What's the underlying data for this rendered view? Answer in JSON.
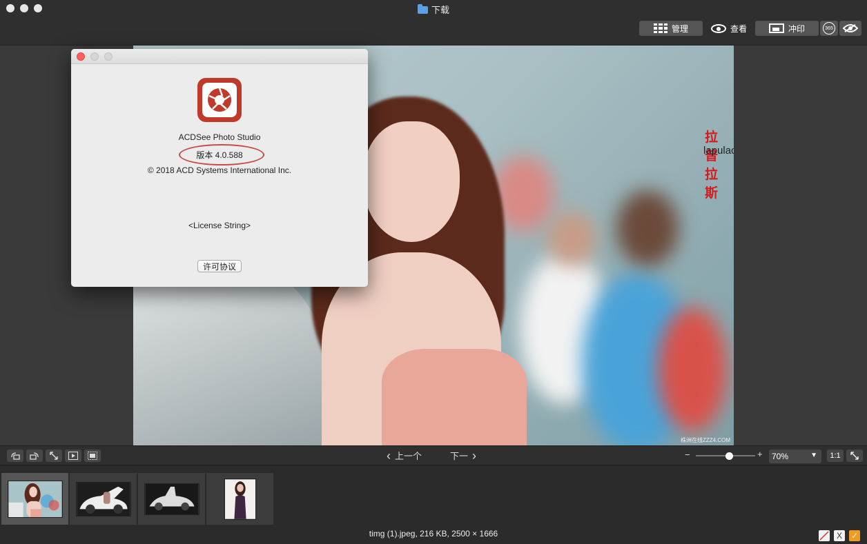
{
  "window": {
    "title": "下载",
    "icon": "folder-icon"
  },
  "toolbar": {
    "manage_label": "管理",
    "view_label": "查看",
    "develop_label": "冲印",
    "badge_365": "365"
  },
  "photo": {
    "watermark_cn": "拉普拉斯",
    "watermark_en": "lapulace.com",
    "corner_mark": "株洲在线ZZZ4.COM"
  },
  "about": {
    "app_name": "ACDSee Photo Studio",
    "version": "版本 4.0.588",
    "copyright": "© 2018 ACD Systems International Inc.",
    "license_string": "<License String>",
    "license_button": "许可协议"
  },
  "controls": {
    "prev_label": "上一个",
    "next_label": "下一",
    "zoom_minus": "−",
    "zoom_plus": "+",
    "zoom_level": 0.56,
    "zoom_value": "70%",
    "one_to_one": "1:1"
  },
  "filmstrip": {
    "selected_index": 0,
    "items": [
      {
        "name": "thumb-woman-street"
      },
      {
        "name": "thumb-white-car-open"
      },
      {
        "name": "thumb-white-car"
      },
      {
        "name": "thumb-woman-dress"
      }
    ]
  },
  "status": {
    "file_info": "timg (1).jpeg, 216 KB, 2500 × 1666",
    "flag_x": "X",
    "flag_check": "✓"
  },
  "colors": {
    "accent_red": "#c0392b",
    "flag_orange": "#f29b21",
    "watermark_red": "#d21c1c"
  }
}
